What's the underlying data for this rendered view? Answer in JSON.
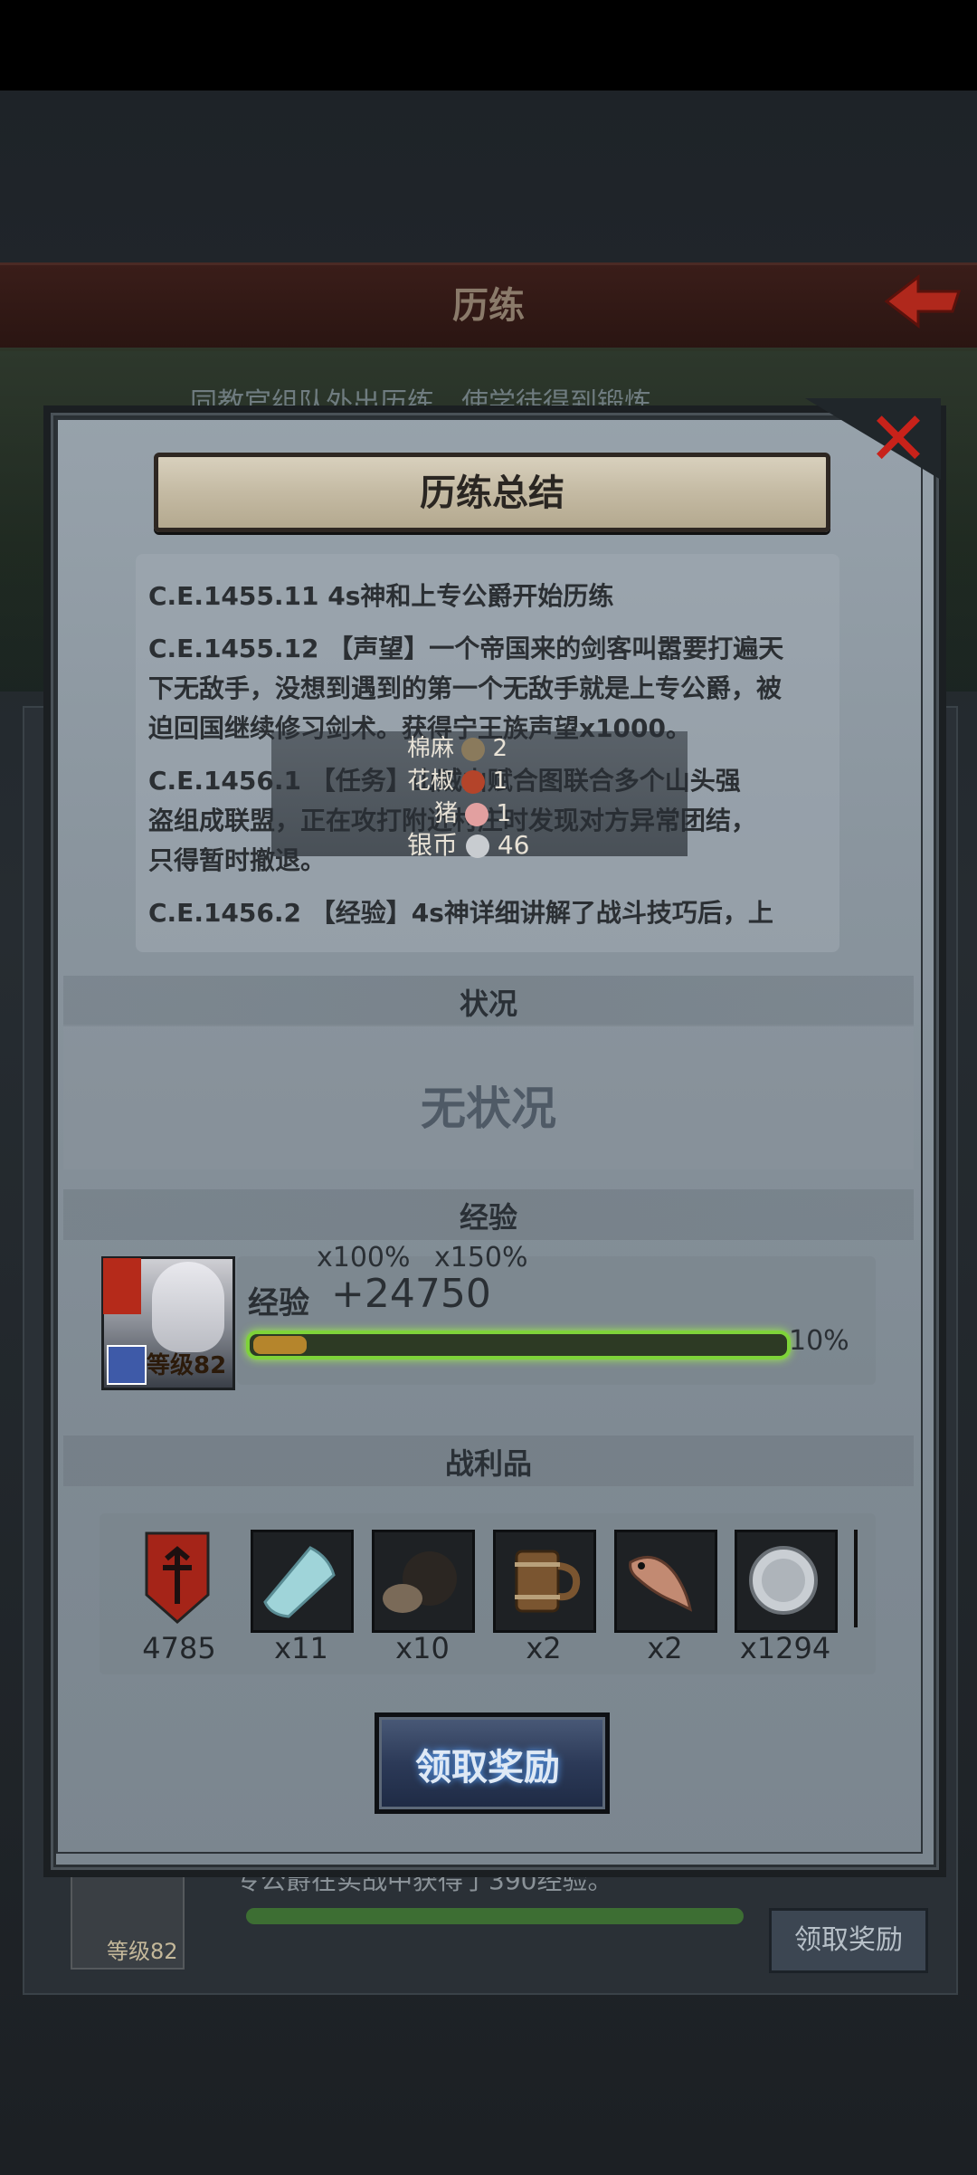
{
  "background": {
    "header_title": "历练",
    "subtitle": "同教官组队外出历练，使学徒得到锻炼",
    "exp_message": "专公爵在实战中获得了390经验。",
    "portrait_level": "等级82",
    "claim_label": "领取奖励"
  },
  "dialog": {
    "title": "历练总结",
    "log": [
      "C.E.1455.11  4s神和上专公爵开始历练",
      "C.E.1455.12  【声望】一个帝国来的剑客叫嚣要打遍天",
      "下无敌手，没想到遇到的第一个无敌手就是上专公爵，被",
      "迫回国继续修习剑术。获得宁王族声望x1000。",
      "C.E.1456.1  【任务】山贼山赋合图联合多个山头强",
      "盗组成联盟，正在攻打附近村庄时发现对方异常团结，",
      "只得暂时撤退。",
      "C.E.1456.2  【经验】4s神详细讲解了战斗技巧后，上"
    ],
    "tooltip": [
      {
        "name": "棉麻",
        "count": "2"
      },
      {
        "name": "花椒",
        "count": "1"
      },
      {
        "name": "猪",
        "count": "1"
      },
      {
        "name": "银币",
        "count": "46"
      }
    ],
    "status_section": "状况",
    "status_value": "无状况",
    "exp_section": "经验",
    "portrait_level": "等级82",
    "mult_1": "x100%",
    "mult_2": "x150%",
    "exp_label": "经验",
    "exp_value": "+24750",
    "exp_progress_pct": 10,
    "exp_pct_label": "10%",
    "loot_section": "战利品",
    "loot": [
      {
        "icon": "red-banner-icon",
        "qty": "4785"
      },
      {
        "icon": "cloth-bolt-icon",
        "qty": "x11"
      },
      {
        "icon": "truffle-icon",
        "qty": "x10"
      },
      {
        "icon": "wooden-mug-icon",
        "qty": "x2"
      },
      {
        "icon": "fish-icon",
        "qty": "x2"
      },
      {
        "icon": "silver-coin-icon",
        "qty": "x1294"
      }
    ],
    "claim_label": "领取奖励"
  }
}
